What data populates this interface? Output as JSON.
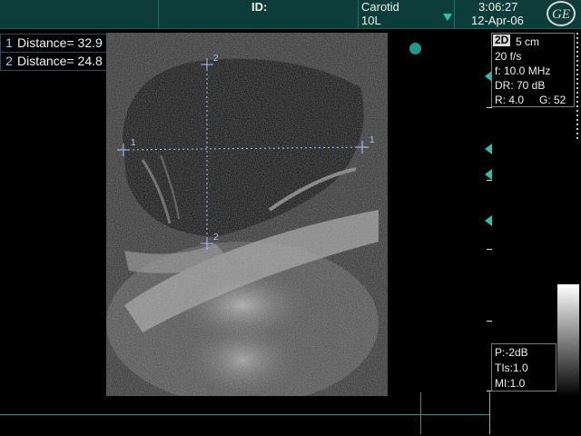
{
  "header": {
    "id_label": "ID:",
    "preset": "Carotid",
    "probe": "10L",
    "time": "3:06:27",
    "date": "12-Apr-06",
    "logo_text": "GE"
  },
  "measurements": [
    {
      "index": "1",
      "label": "Distance=",
      "value": "32.9 mm"
    },
    {
      "index": "2",
      "label": "Distance=",
      "value": "24.8 mm"
    }
  ],
  "calipers": {
    "h_label": "1",
    "v_label": "2"
  },
  "params": {
    "mode": "2D",
    "depth": "5 cm",
    "frame_rate": "20 f/s",
    "frequency": "f: 10.0 MHz",
    "dynamic_range": "DR: 70 dB",
    "rejection": "R: 4.0",
    "gain": "G: 52"
  },
  "power": {
    "p": "P:-2dB",
    "tis": "TIs:1.0",
    "mi": "MI:1.0"
  },
  "colors": {
    "accent": "#27c2b0",
    "header_bg": "#0d3d3a",
    "caliper": "#a9c8ff"
  },
  "icons": {
    "logo": "ge-logo-icon",
    "menu": "triangle-down-icon",
    "focus": "focus-marker-icon"
  }
}
